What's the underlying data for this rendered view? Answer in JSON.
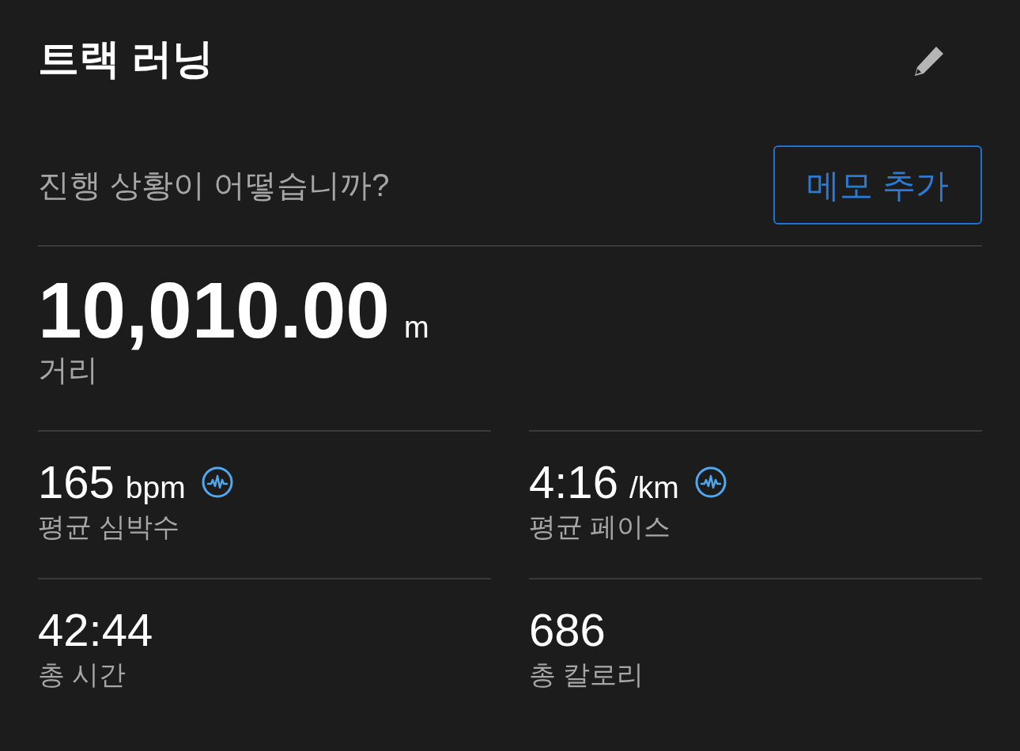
{
  "header": {
    "title": "트랙 러닝"
  },
  "note_prompt": {
    "text": "진행 상황이 어떻습니까?",
    "button": "메모 추가"
  },
  "distance": {
    "value": "10,010.00",
    "unit": "m",
    "label": "거리"
  },
  "metrics": [
    {
      "value": "165",
      "unit": "bpm",
      "label": "평균 심박수",
      "sensor_data": true
    },
    {
      "value": "4:16",
      "unit": "/km",
      "label": "평균 페이스",
      "sensor_data": true
    },
    {
      "value": "42:44",
      "label": "총 시간",
      "sensor_data": false
    },
    {
      "value": "686",
      "label": "총 칼로리",
      "sensor_data": false
    }
  ]
}
